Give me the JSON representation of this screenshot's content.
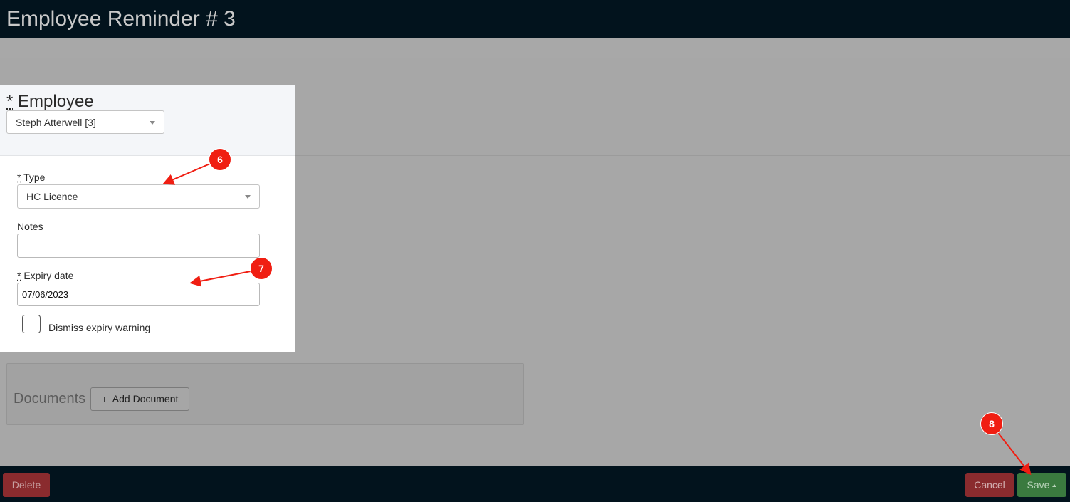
{
  "header": {
    "title": "Employee Reminder # 3"
  },
  "form": {
    "employee": {
      "required_mark": "*",
      "label": "Employee",
      "value": "Steph Atterwell [3]"
    },
    "type": {
      "required_mark": "*",
      "label": "Type",
      "value": "HC Licence"
    },
    "notes": {
      "label": "Notes",
      "value": ""
    },
    "expiry": {
      "required_mark": "*",
      "label": "Expiry date",
      "value": "07/06/2023"
    },
    "dismiss": {
      "label": "Dismiss expiry warning",
      "checked": false
    }
  },
  "documents": {
    "title": "Documents",
    "add_icon": "plus-icon",
    "add_label": "Add Document"
  },
  "footer": {
    "delete_label": "Delete",
    "cancel_label": "Cancel",
    "save_label": "Save"
  },
  "annotations": [
    {
      "number": "6"
    },
    {
      "number": "7"
    },
    {
      "number": "8"
    }
  ],
  "colors": {
    "header_bg": "#02131d",
    "overlay": "#a7a7a7",
    "danger": "#8a2b2e",
    "success": "#3a7a3f",
    "annotation": "#f01e12"
  }
}
